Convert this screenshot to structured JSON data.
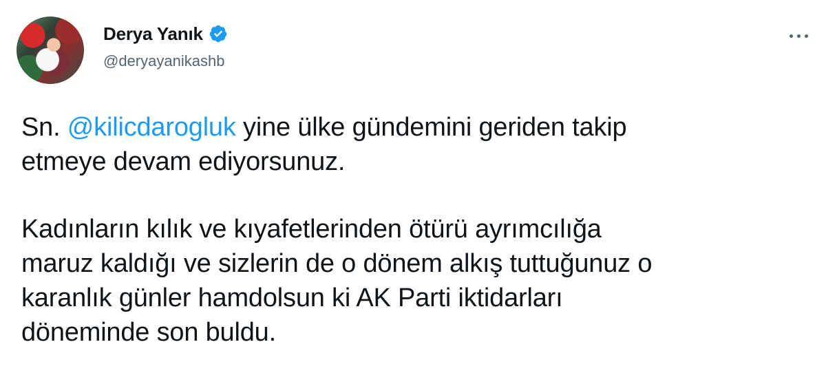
{
  "author": {
    "display_name": "Derya Yanık",
    "handle": "@deryayanikashb",
    "verified_icon": "verified-badge-icon",
    "accent_color": "#1d9bf0"
  },
  "actions": {
    "more_icon": "more-options-icon"
  },
  "tweet": {
    "p1_prefix": "Sn. ",
    "mention": "@kilicdarogluk",
    "p1_line1_suffix": " yine ülke gündemini geriden takip",
    "p1_line2": "etmeye devam ediyorsunuz.",
    "p2_line1": "Kadınların kılık ve kıyafetlerinden ötürü ayrımcılığa",
    "p2_line2": "maruz kaldığı ve sizlerin de o dönem alkış tuttuğunuz o",
    "p2_line3": "karanlık günler hamdolsun ki AK Parti iktidarları",
    "p2_line4": "döneminde son buldu."
  }
}
